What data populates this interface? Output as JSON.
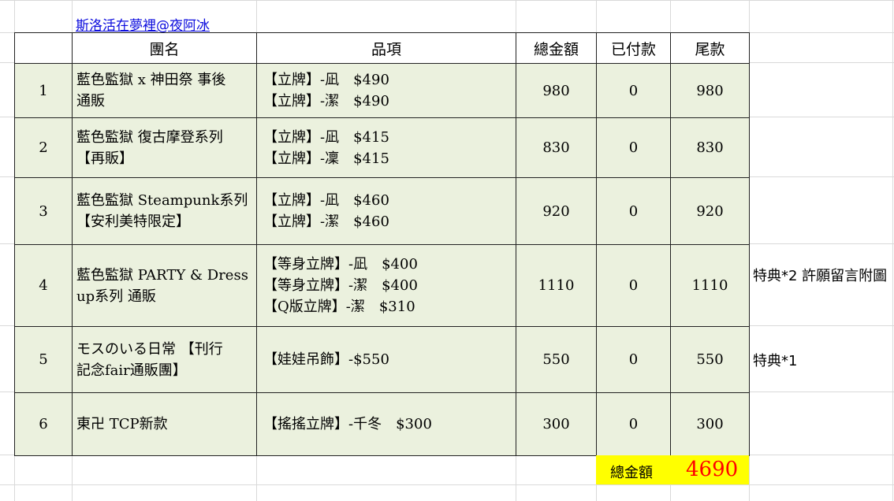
{
  "link_text": "斯洛活在夢裡@夜阿冰",
  "headers": {
    "index": "",
    "group": "團名",
    "items": "品項",
    "total": "總金額",
    "paid": "已付款",
    "balance": "尾款"
  },
  "rows": [
    {
      "index": "1",
      "group_lines": [
        "藍色監獄 x 神田祭 事後",
        "通販"
      ],
      "items": [
        "【立牌】-凪　$490",
        "【立牌】-潔　$490"
      ],
      "total": "980",
      "paid": "0",
      "balance": "980",
      "note": ""
    },
    {
      "index": "2",
      "group_lines": [
        "藍色監獄 復古摩登系列",
        "【再販】"
      ],
      "items": [
        "【立牌】-凪　$415",
        "【立牌】-凜　$415"
      ],
      "total": "830",
      "paid": "0",
      "balance": "830",
      "note": ""
    },
    {
      "index": "3",
      "group_lines": [
        "藍色監獄 Steampunk系列",
        "【安利美特限定】"
      ],
      "items": [
        "【立牌】-凪　$460",
        "【立牌】-潔　$460"
      ],
      "total": "920",
      "paid": "0",
      "balance": "920",
      "note": ""
    },
    {
      "index": "4",
      "group_lines": [
        "藍色監獄 PARTY & Dress",
        "up系列 通販"
      ],
      "items": [
        "【等身立牌】-凪　$400",
        "【等身立牌】-潔　$400",
        "【Q版立牌】-潔　$310"
      ],
      "total": "1110",
      "paid": "0",
      "balance": "1110",
      "note": "特典*2 許願留言附圖"
    },
    {
      "index": "5",
      "group_lines": [
        "モスのいる日常 【刊行",
        "記念fair通販團】"
      ],
      "items": [
        "【娃娃吊飾】-$550"
      ],
      "total": "550",
      "paid": "0",
      "balance": "550",
      "note": "特典*1"
    },
    {
      "index": "6",
      "group_lines": [
        "東卍 TCP新款"
      ],
      "items": [
        "【搖搖立牌】-千冬　$300"
      ],
      "total": "300",
      "paid": "0",
      "balance": "300",
      "note": ""
    }
  ],
  "summary": {
    "label": "總金額",
    "value": "4690"
  },
  "colors": {
    "row_fill": "#ebf1de",
    "total_fill": "#ffff00",
    "total_value": "#ff0000",
    "link": "#0a0add"
  }
}
